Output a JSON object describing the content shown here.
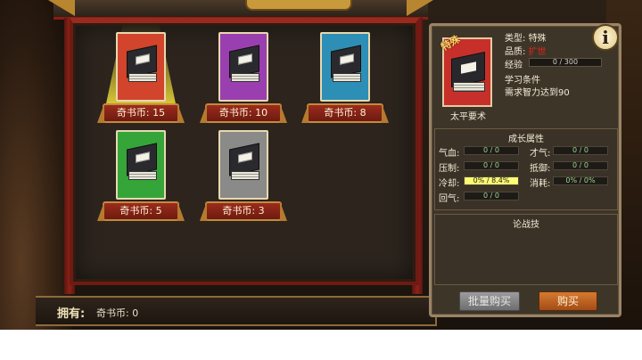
{
  "shop": {
    "title": "",
    "items": [
      {
        "price_label": "奇书币: 15",
        "card_color": "#d2442b",
        "selected": true
      },
      {
        "price_label": "奇书币: 10",
        "card_color": "#9a3fb0",
        "selected": false
      },
      {
        "price_label": "奇书币: 8",
        "card_color": "#2d8fb5",
        "selected": false
      },
      {
        "price_label": "奇书币: 5",
        "card_color": "#35a53a",
        "selected": false
      },
      {
        "price_label": "奇书币: 3",
        "card_color": "#8a8a88",
        "selected": false
      }
    ],
    "own_label": "拥有:",
    "own_value": "奇书币: 0"
  },
  "detail": {
    "info_icon": "i",
    "item_name": "太平要术",
    "card_tag": "特殊",
    "type_label": "类型:",
    "type_value": "特殊",
    "quality_label": "品质:",
    "quality_value": "扩世",
    "exp_label": "经验",
    "exp_value": "0 / 300",
    "req_title": "学习条件",
    "req_text": "需求智力达到90",
    "growth_title": "成长属性",
    "stats": [
      {
        "label": "气血:",
        "value": "0 / 0"
      },
      {
        "label": "才气:",
        "value": "0 / 0"
      },
      {
        "label": "压制:",
        "value": "0 / 0"
      },
      {
        "label": "抵御:",
        "value": "0 / 0"
      },
      {
        "label": "冷却:",
        "value": "0% / 8.4%"
      },
      {
        "label": "消耗:",
        "value": "0% / 0%"
      },
      {
        "label": "回气:",
        "value": "0 / 0"
      }
    ],
    "skill_title": "论战技",
    "bulk_buy": "批量购买",
    "buy": "购买"
  }
}
